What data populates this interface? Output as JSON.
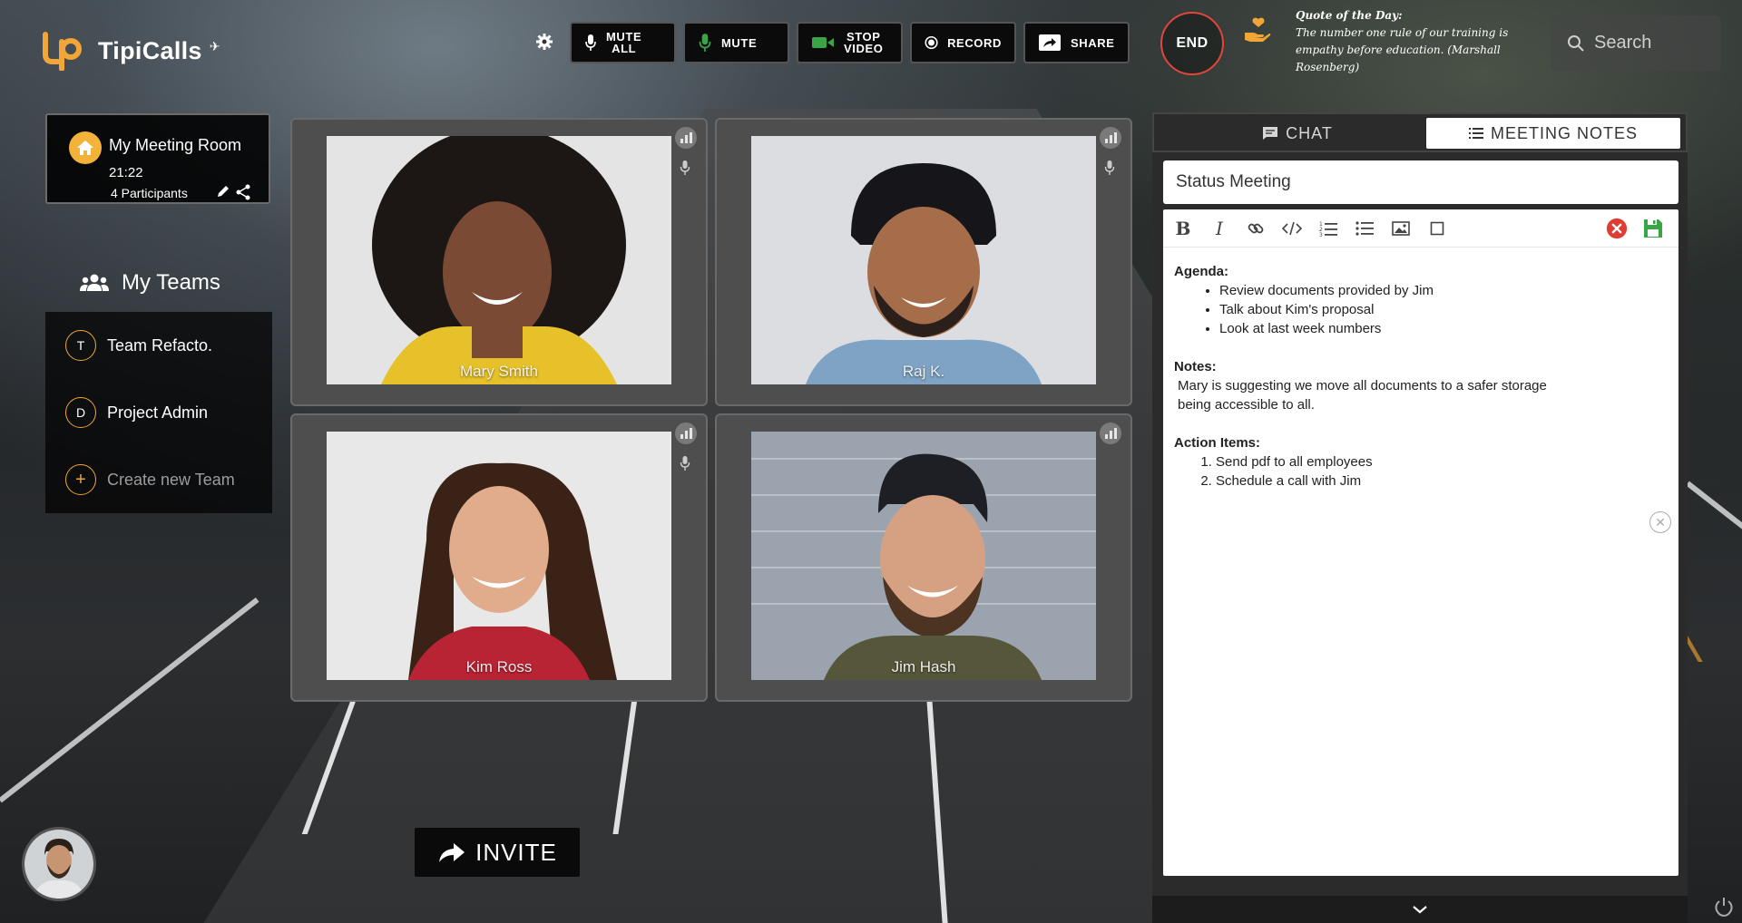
{
  "app": {
    "name": "TipiCalls"
  },
  "toolbar": {
    "mute_all": [
      "MUTE",
      "ALL"
    ],
    "mute": "MUTE",
    "stop_video": [
      "STOP",
      "VIDEO"
    ],
    "record": "RECORD",
    "share": "SHARE",
    "end": "END"
  },
  "quote": {
    "title": "Quote of the Day:",
    "text": "The number one rule of our training is empathy before education. (Marshall Rosenberg)"
  },
  "search": {
    "placeholder": "Search"
  },
  "room": {
    "title": "My Meeting Room",
    "time": "21:22",
    "participants": "4 Participants"
  },
  "teams": {
    "heading": "My Teams",
    "items": [
      {
        "badge": "T",
        "name": "Team Refacto."
      },
      {
        "badge": "D",
        "name": "Project Admin"
      }
    ],
    "create": {
      "badge": "+",
      "name": "Create new Team"
    }
  },
  "participants": [
    {
      "name": "Mary Smith",
      "muted": false
    },
    {
      "name": "Raj K.",
      "muted": false
    },
    {
      "name": "Kim Ross",
      "muted": false
    },
    {
      "name": "Jim Hash",
      "muted": true
    }
  ],
  "invite": {
    "label": "INVITE"
  },
  "notes": {
    "tabs": {
      "chat": "CHAT",
      "meeting_notes": "MEETING NOTES"
    },
    "title": "Status Meeting",
    "agenda_label": "Agenda:",
    "agenda": [
      "Review documents provided by Jim",
      "Talk about Kim's proposal",
      "Look at last week numbers"
    ],
    "notes_label": "Notes:",
    "notes_text_1": "Mary is suggesting we move all documents to a safer storage",
    "notes_text_2": "being accessible to all.",
    "actions_label": "Action Items:",
    "actions": [
      "Send pdf to all employees",
      "Schedule a call with Jim"
    ]
  },
  "colors": {
    "accent": "#f1a637",
    "end_ring": "#e0463c",
    "cancel": "#e03c31",
    "save": "#3aa547"
  }
}
